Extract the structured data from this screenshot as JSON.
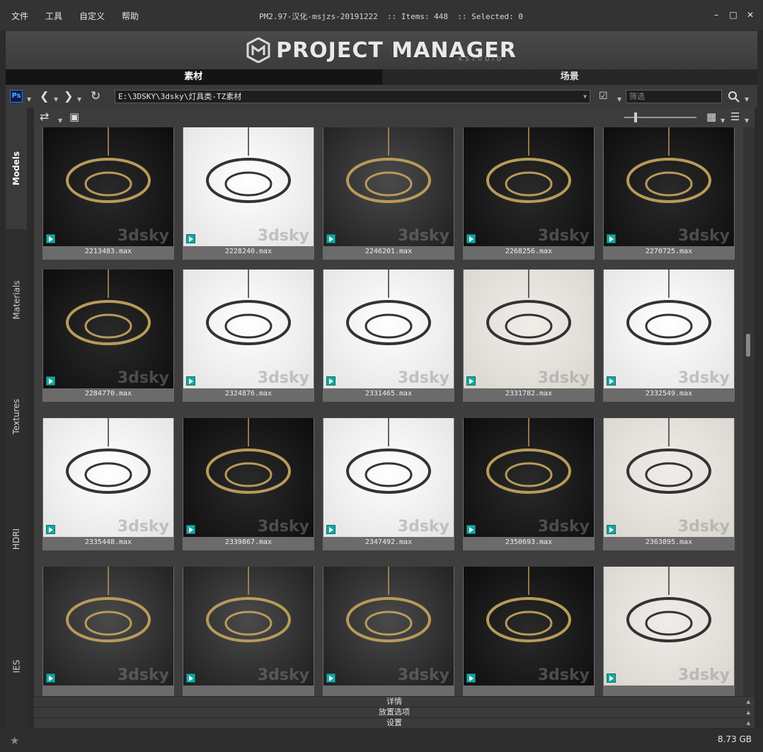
{
  "menu": [
    "文件",
    "工具",
    "自定义",
    "帮助"
  ],
  "window": {
    "title": "PM2.97-汉化-msjzs-20191222",
    "items_label": ":: Items: 448",
    "selected_label": ":: Selected: 0"
  },
  "banner": {
    "logo_text": "PROJECT MANAGER",
    "logo_sub": "KSTUDIO"
  },
  "tabs": [
    {
      "label": "素材",
      "active": true
    },
    {
      "label": "场景",
      "active": false
    }
  ],
  "toolbar": {
    "path": "E:\\3DSKY\\3dsky\\灯具类-TZ素材",
    "filter_placeholder": "筛选"
  },
  "side_tabs": [
    "Models",
    "Materials",
    "Textures",
    "HDRI",
    "IES"
  ],
  "grid": [
    {
      "name": "2213483.max",
      "bg": "dark"
    },
    {
      "name": "2228240.max",
      "bg": "light"
    },
    {
      "name": "2246201.max",
      "bg": "grey"
    },
    {
      "name": "2268256.max",
      "bg": "dark"
    },
    {
      "name": "2270725.max",
      "bg": "dark"
    },
    {
      "name": "2284770.max",
      "bg": "dark"
    },
    {
      "name": "2324876.max",
      "bg": "light"
    },
    {
      "name": "2331465.max",
      "bg": "light"
    },
    {
      "name": "2331782.max",
      "bg": "beige"
    },
    {
      "name": "2332549.max",
      "bg": "light"
    },
    {
      "name": "2335448.max",
      "bg": "light"
    },
    {
      "name": "2339867.max",
      "bg": "dark"
    },
    {
      "name": "2347492.max",
      "bg": "light"
    },
    {
      "name": "2350693.max",
      "bg": "dark"
    },
    {
      "name": "2363895.max",
      "bg": "beige"
    },
    {
      "name": "",
      "bg": "grey"
    },
    {
      "name": "",
      "bg": "grey"
    },
    {
      "name": "",
      "bg": "grey"
    },
    {
      "name": "",
      "bg": "dark"
    },
    {
      "name": "",
      "bg": "beige"
    }
  ],
  "watermark": "3dsky",
  "panels": [
    "详情",
    "放置选项",
    "设置"
  ],
  "status": {
    "disk": "8.73 GB"
  },
  "colors": {
    "max_icon": "#18a6a0",
    "active_tab": "#141414"
  }
}
